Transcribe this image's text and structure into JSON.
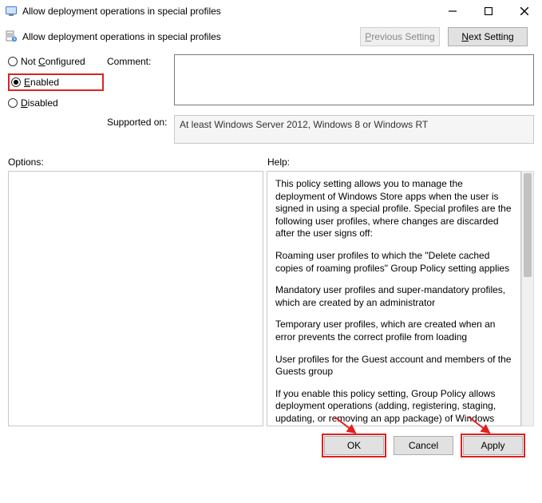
{
  "window": {
    "title": "Allow deployment operations in special profiles"
  },
  "header": {
    "policy_title": "Allow deployment operations in special profiles",
    "previous_setting": "Previous Setting",
    "next_setting": "Next Setting"
  },
  "state": {
    "not_configured": "Not Configured",
    "enabled": "Enabled",
    "disabled": "Disabled",
    "selected": "enabled"
  },
  "labels": {
    "comment": "Comment:",
    "supported_on": "Supported on:",
    "options": "Options:",
    "help": "Help:"
  },
  "comment_value": "",
  "supported_on_text": "At least Windows Server 2012, Windows 8 or Windows RT",
  "help_paragraphs": [
    "This policy setting allows you to manage the deployment of Windows Store apps when the user is signed in using a special profile. Special profiles are the following user profiles, where changes are discarded after the user signs off:",
    "Roaming user profiles to which the \"Delete cached copies of roaming profiles\" Group Policy setting applies",
    "Mandatory user profiles and super-mandatory profiles, which are created by an administrator",
    "Temporary user profiles, which are created when an error prevents the correct profile from loading",
    "User profiles for the Guest account and members of the Guests group",
    "If you enable this policy setting, Group Policy allows deployment operations (adding, registering, staging, updating, or removing an app package) of Windows Store apps when using a special"
  ],
  "buttons": {
    "ok": "OK",
    "cancel": "Cancel",
    "apply": "Apply"
  }
}
